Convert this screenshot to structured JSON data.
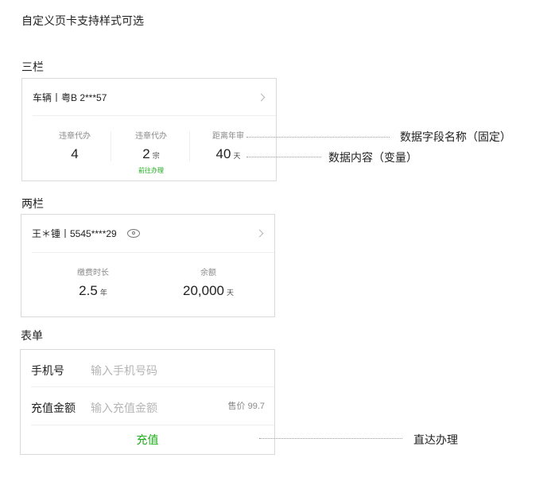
{
  "page_title": "自定义页卡支持样式可选",
  "three_col": {
    "section_label": "三栏",
    "header_text": "车辆丨粤B 2***57",
    "stats": [
      {
        "label": "违章代办",
        "value": "4",
        "unit": "",
        "link": ""
      },
      {
        "label": "违章代办",
        "value": "2",
        "unit": "宗",
        "link": "前往办理"
      },
      {
        "label": "距离年审",
        "value": "40",
        "unit": "天",
        "link": ""
      }
    ]
  },
  "two_col": {
    "section_label": "两栏",
    "header_text": "王＊锺丨5545****29",
    "stats": [
      {
        "label": "缴费时长",
        "value": "2.5",
        "unit": "年"
      },
      {
        "label": "余额",
        "value": "20,000",
        "unit": "天"
      }
    ]
  },
  "form": {
    "section_label": "表单",
    "phone": {
      "label": "手机号",
      "placeholder": "输入手机号码"
    },
    "amount": {
      "label": "充值金额",
      "placeholder": "输入充值金额",
      "price_note": "售价 99.7"
    },
    "submit_label": "充值"
  },
  "annotations": {
    "field_name": "数据字段名称（固定）",
    "field_content": "数据内容（变量）",
    "direct_action": "直达办理"
  },
  "colors": {
    "accent_green": "#1aad19",
    "label_gray": "#8a8a8a",
    "border": "#d9d9d9"
  },
  "icons": {
    "header_arrow": "chevron-right-icon",
    "privacy_toggle": "eye-icon"
  }
}
